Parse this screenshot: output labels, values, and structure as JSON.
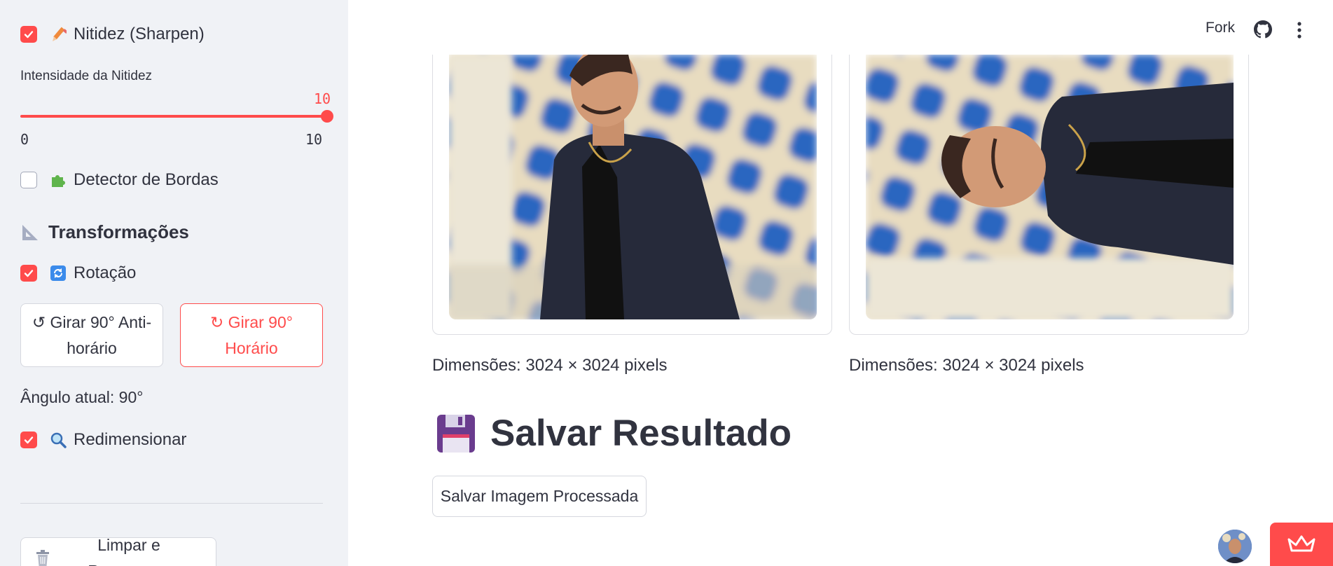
{
  "sidebar": {
    "sharpen": {
      "label": "Nitidez (Sharpen)",
      "checked": true,
      "emoji": "pencil-icon"
    },
    "sharpen_slider": {
      "label": "Intensidade da Nitidez",
      "value": "10",
      "min": "0",
      "max": "10",
      "fraction": 1.0
    },
    "edges": {
      "label": "Detector de Bordas",
      "checked": false,
      "emoji": "puzzle-icon"
    },
    "transform_title": "Transformações",
    "rotation": {
      "label": "Rotação",
      "checked": true,
      "emoji": "rotate-icon"
    },
    "rotate_ccw_button": "↺ Girar 90° Anti-horário",
    "rotate_cw_button": "↻ Girar 90° Horário",
    "current_angle": "Ângulo atual: 90°",
    "resize": {
      "label": "Redimensionar",
      "checked": true,
      "emoji": "magnifier-icon"
    },
    "reset_button": "Limpar e Recomeçar"
  },
  "header": {
    "fork_label": "Fork"
  },
  "main": {
    "original_dimensions": "Dimensões: 3024 × 3024 pixels",
    "processed_dimensions": "Dimensões: 3024 × 3024 pixels",
    "save_title": "Salvar Resultado",
    "save_button": "Salvar Imagem Processada"
  },
  "colors": {
    "accent": "#ff4b4b",
    "sidebar_bg": "#f0f2f6",
    "text": "#31333f",
    "streamlit_badge": "#ff4b4b"
  }
}
